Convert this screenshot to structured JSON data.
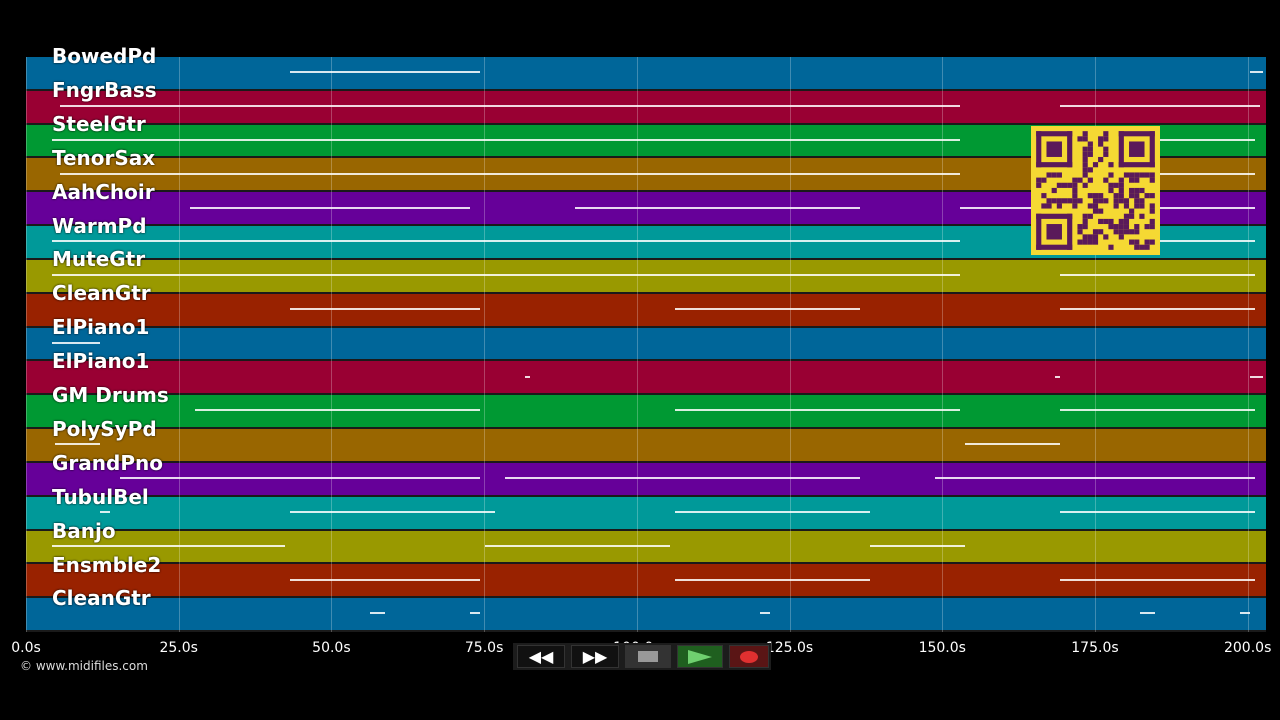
{
  "tracks": [
    {
      "name": "BowedPd",
      "color": "#006699"
    },
    {
      "name": "FngrBass",
      "color": "#990033"
    },
    {
      "name": "SteelGtr",
      "color": "#009933"
    },
    {
      "name": "TenorSax",
      "color": "#996600"
    },
    {
      "name": "AahChoir",
      "color": "#660099"
    },
    {
      "name": "WarmPd",
      "color": "#009999"
    },
    {
      "name": "MuteGtr",
      "color": "#999900"
    },
    {
      "name": "CleanGtr",
      "color": "#992200"
    },
    {
      "name": "ElPiano1",
      "color": "#006699"
    },
    {
      "name": "ElPiano1",
      "color": "#990033"
    },
    {
      "name": "GM Drums",
      "color": "#009933"
    },
    {
      "name": "PolySyPd",
      "color": "#996600"
    },
    {
      "name": "GrandPno",
      "color": "#660099"
    },
    {
      "name": "TubulBel",
      "color": "#009999"
    },
    {
      "name": "Banjo",
      "color": "#999900"
    },
    {
      "name": "Ensmble2",
      "color": "#992200"
    },
    {
      "name": "CleanGtr",
      "color": "#006699"
    }
  ],
  "timeline": {
    "ticks": [
      "0.0s",
      "25.0s",
      "50.0s",
      "75.0s",
      "100.0s",
      "125.0s",
      "150.0s",
      "175.0s",
      "200.0s"
    ],
    "tick_values": [
      0,
      25,
      50,
      75,
      100,
      125,
      150,
      175,
      200
    ],
    "max_seconds": 203
  },
  "copyright": "© www.midifiles.com",
  "transport": {
    "rewind_icon": "rewind-icon",
    "fast_forward_icon": "fast-forward-icon",
    "stop_icon": "stop-icon",
    "play_icon": "play-icon",
    "record_icon": "record-icon"
  },
  "qr_icon": "qr-code-icon"
}
